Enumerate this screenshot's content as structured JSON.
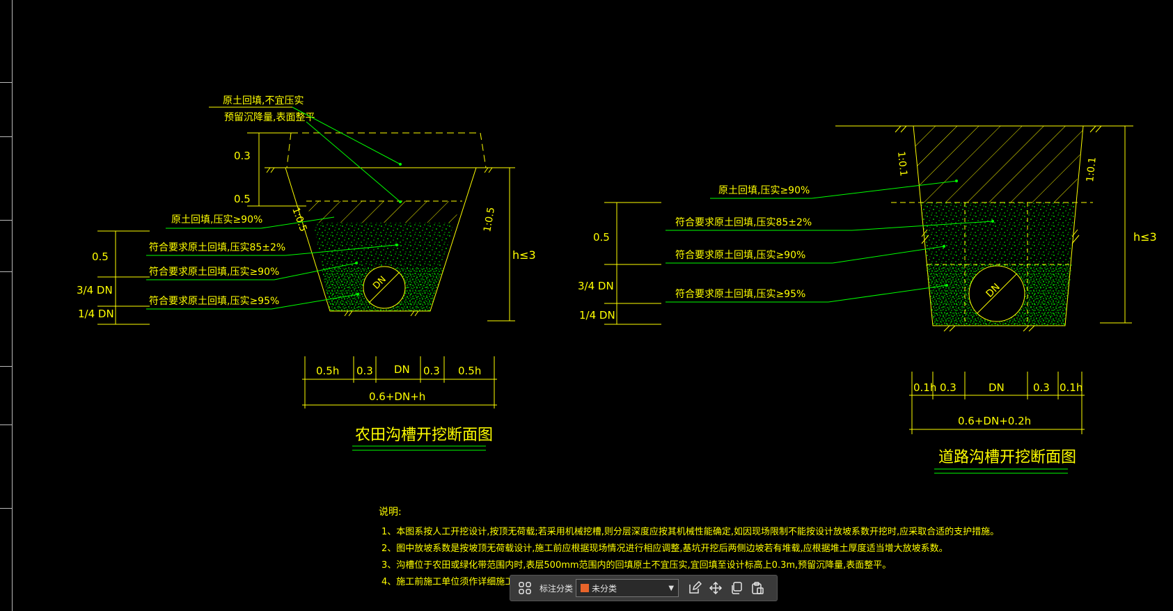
{
  "colors": {
    "background": "#000000",
    "line_yellow": "#ffff00",
    "line_green": "#00ff00",
    "line_white": "#ffffff",
    "toolbar_bg": "#3a3a3a",
    "swatch": "#e8642a"
  },
  "drawing_left": {
    "labels": {
      "note1": "原土回填,不宜压实",
      "note2": "预留沉降量,表面整平",
      "dim_03": "0.3",
      "dim_05": "0.5",
      "fill1": "原土回填,压实≥90%",
      "fill2": "符合要求原土回填,压实85±2%",
      "fill3": "符合要求原土回填,压实≥90%",
      "fill4": "符合要求原土回填,压实≥95%",
      "side_05": "0.5",
      "side_34dn": "3/4 DN",
      "side_14dn": "1/4 DN",
      "slope_left": "1:0.5",
      "slope_right": "1:0.5",
      "depth": "h≤3",
      "pipe": "DN",
      "bw1": "0.5h",
      "bw2": "0.3",
      "bw3": "DN",
      "bw4": "0.3",
      "bw5": "0.5h",
      "total": "0.6+DN+h",
      "title": "农田沟槽开挖断面图"
    }
  },
  "drawing_right": {
    "labels": {
      "fill1": "原土回填,压实≥90%",
      "fill2": "符合要求原土回填,压实85±2%",
      "fill3": "符合要求原土回填,压实≥90%",
      "fill4": "符合要求原土回填,压实≥95%",
      "side_05": "0.5",
      "side_34dn": "3/4 DN",
      "side_14dn": "1/4 DN",
      "slope_left": "1:0.1",
      "slope_right": "1:0.1",
      "depth": "h≤3",
      "pipe": "DN",
      "bw1": "0.1h",
      "bw2": "0.3",
      "bw3": "DN",
      "bw4": "0.3",
      "bw5": "0.1h",
      "total": "0.6+DN+0.2h",
      "title": "道路沟槽开挖断面图"
    }
  },
  "notes": {
    "heading": "说明:",
    "lines": [
      "1、本图系按人工开挖设计,按顶无荷载;若采用机械挖槽,则分层深度应按其机械性能确定,如因现场限制不能按设计放坡系数开挖时,应采取合适的支护措施。",
      "2、图中放坡系数是按坡顶无荷载设计,施工前应根据现场情况进行相应调整,基坑开挖后两侧边坡若有堆载,应根据堆土厚度适当增大放坡系数。",
      "3、沟槽位于农田或绿化带范围内时,表层500mm范围内的回填原土不宜压实,宜回填至设计标高上0.3m,预留沉降量,表面整平。",
      "4、施工前施工单位须作详细施工组织设计。"
    ]
  },
  "toolbar": {
    "label": "标注分类",
    "select_value": "未分类",
    "icons": [
      "grid-icon",
      "edit-icon",
      "move-icon",
      "copy-icon",
      "paste-icon"
    ]
  }
}
